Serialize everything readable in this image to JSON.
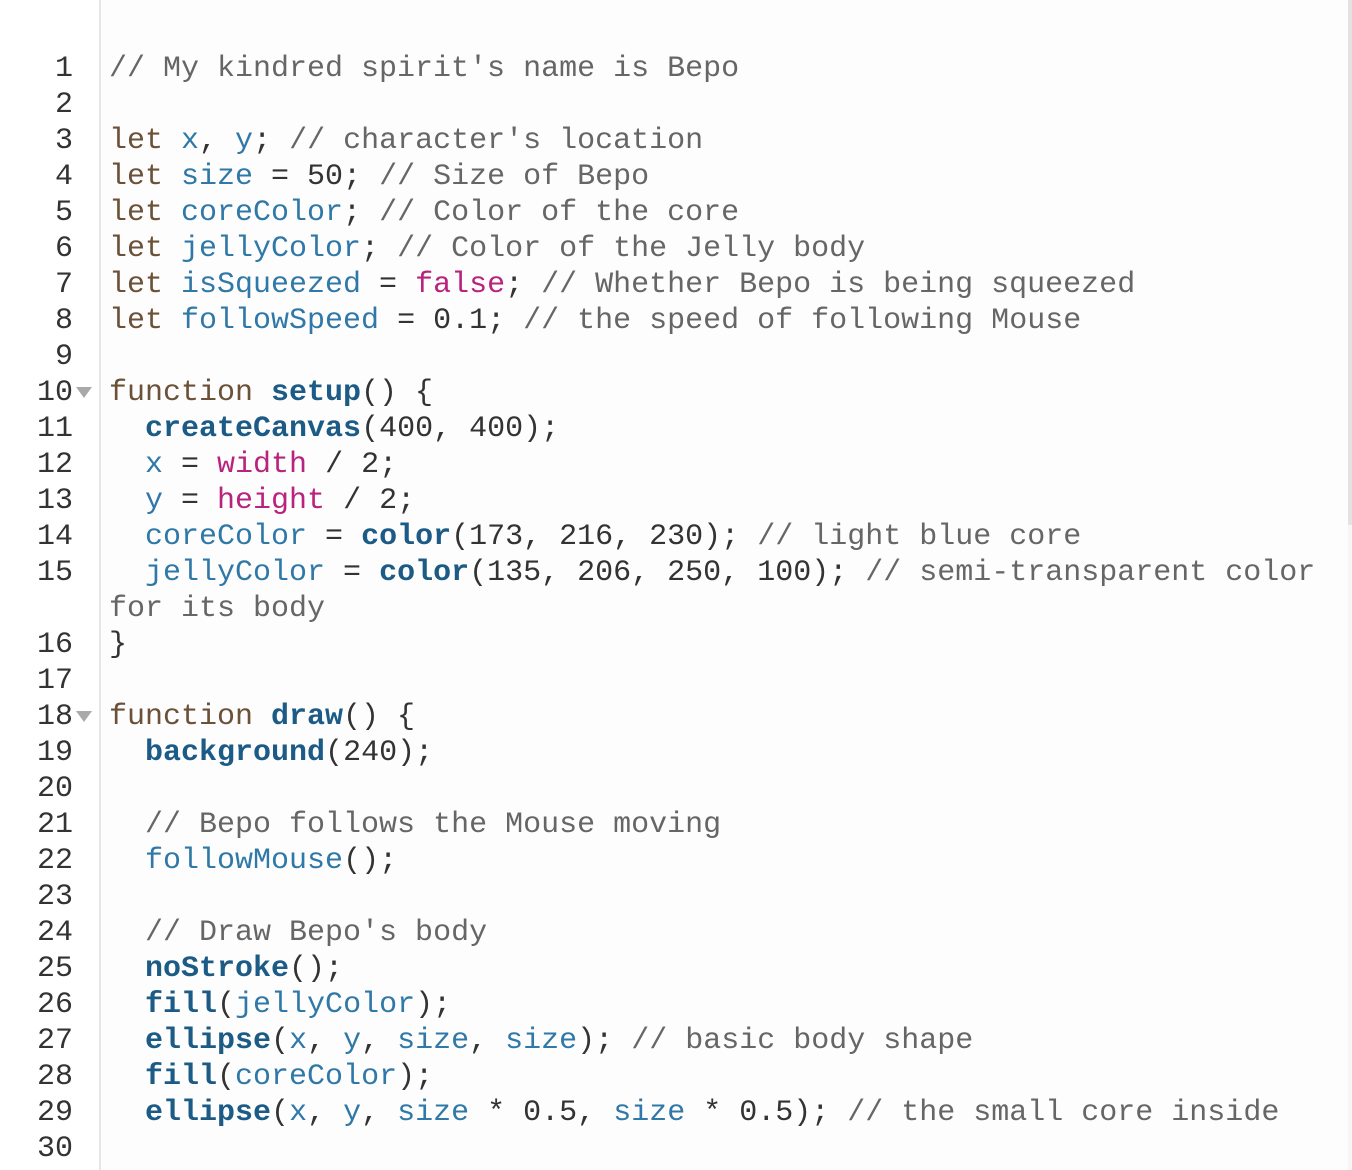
{
  "editor": {
    "lines": [
      {
        "n": "1",
        "fold": false,
        "tokens": [
          [
            "cm",
            "// My kindred spirit's name is Bepo"
          ]
        ]
      },
      {
        "n": "2",
        "fold": false,
        "tokens": []
      },
      {
        "n": "3",
        "fold": false,
        "tokens": [
          [
            "kw",
            "let "
          ],
          [
            "vr",
            "x"
          ],
          [
            "op",
            ", "
          ],
          [
            "vr",
            "y"
          ],
          [
            "op",
            "; "
          ],
          [
            "cm",
            "// character's location"
          ]
        ]
      },
      {
        "n": "4",
        "fold": false,
        "tokens": [
          [
            "kw",
            "let "
          ],
          [
            "vr",
            "size"
          ],
          [
            "op",
            " = "
          ],
          [
            "nm",
            "50"
          ],
          [
            "op",
            "; "
          ],
          [
            "cm",
            "// Size of Bepo"
          ]
        ]
      },
      {
        "n": "5",
        "fold": false,
        "tokens": [
          [
            "kw",
            "let "
          ],
          [
            "vr",
            "coreColor"
          ],
          [
            "op",
            "; "
          ],
          [
            "cm",
            "// Color of the core"
          ]
        ]
      },
      {
        "n": "6",
        "fold": false,
        "tokens": [
          [
            "kw",
            "let "
          ],
          [
            "vr",
            "jellyColor"
          ],
          [
            "op",
            "; "
          ],
          [
            "cm",
            "// Color of the Jelly body"
          ]
        ]
      },
      {
        "n": "7",
        "fold": false,
        "tokens": [
          [
            "kw",
            "let "
          ],
          [
            "vr",
            "isSqueezed"
          ],
          [
            "op",
            " = "
          ],
          [
            "bi",
            "false"
          ],
          [
            "op",
            "; "
          ],
          [
            "cm",
            "// Whether Bepo is being squeezed"
          ]
        ]
      },
      {
        "n": "8",
        "fold": false,
        "tokens": [
          [
            "kw",
            "let "
          ],
          [
            "vr",
            "followSpeed"
          ],
          [
            "op",
            " = "
          ],
          [
            "nm",
            "0.1"
          ],
          [
            "op",
            "; "
          ],
          [
            "cm",
            "// the speed of following Mouse"
          ]
        ]
      },
      {
        "n": "9",
        "fold": false,
        "tokens": []
      },
      {
        "n": "10",
        "fold": true,
        "tokens": [
          [
            "kw",
            "function "
          ],
          [
            "fn",
            "setup"
          ],
          [
            "op",
            "() {"
          ]
        ]
      },
      {
        "n": "11",
        "fold": false,
        "tokens": [
          [
            "op",
            "  "
          ],
          [
            "fn",
            "createCanvas"
          ],
          [
            "op",
            "("
          ],
          [
            "nm",
            "400"
          ],
          [
            "op",
            ", "
          ],
          [
            "nm",
            "400"
          ],
          [
            "op",
            ");"
          ]
        ]
      },
      {
        "n": "12",
        "fold": false,
        "tokens": [
          [
            "op",
            "  "
          ],
          [
            "vr",
            "x"
          ],
          [
            "op",
            " = "
          ],
          [
            "bi",
            "width"
          ],
          [
            "op",
            " / "
          ],
          [
            "nm",
            "2"
          ],
          [
            "op",
            ";"
          ]
        ]
      },
      {
        "n": "13",
        "fold": false,
        "tokens": [
          [
            "op",
            "  "
          ],
          [
            "vr",
            "y"
          ],
          [
            "op",
            " = "
          ],
          [
            "bi",
            "height"
          ],
          [
            "op",
            " / "
          ],
          [
            "nm",
            "2"
          ],
          [
            "op",
            ";"
          ]
        ]
      },
      {
        "n": "14",
        "fold": false,
        "tokens": [
          [
            "op",
            "  "
          ],
          [
            "vr",
            "coreColor"
          ],
          [
            "op",
            " = "
          ],
          [
            "fn",
            "color"
          ],
          [
            "op",
            "("
          ],
          [
            "nm",
            "173"
          ],
          [
            "op",
            ", "
          ],
          [
            "nm",
            "216"
          ],
          [
            "op",
            ", "
          ],
          [
            "nm",
            "230"
          ],
          [
            "op",
            "); "
          ],
          [
            "cm",
            "// light blue core"
          ]
        ]
      },
      {
        "n": "15",
        "fold": false,
        "wrap": true,
        "tokens": [
          [
            "op",
            "  "
          ],
          [
            "vr",
            "jellyColor"
          ],
          [
            "op",
            " = "
          ],
          [
            "fn",
            "color"
          ],
          [
            "op",
            "("
          ],
          [
            "nm",
            "135"
          ],
          [
            "op",
            ", "
          ],
          [
            "nm",
            "206"
          ],
          [
            "op",
            ", "
          ],
          [
            "nm",
            "250"
          ],
          [
            "op",
            ", "
          ],
          [
            "nm",
            "100"
          ],
          [
            "op",
            "); "
          ],
          [
            "cm",
            "// semi-transparent color for its body"
          ]
        ]
      },
      {
        "n": "16",
        "fold": false,
        "tokens": [
          [
            "op",
            "}"
          ]
        ]
      },
      {
        "n": "17",
        "fold": false,
        "tokens": []
      },
      {
        "n": "18",
        "fold": true,
        "tokens": [
          [
            "kw",
            "function "
          ],
          [
            "fn",
            "draw"
          ],
          [
            "op",
            "() {"
          ]
        ]
      },
      {
        "n": "19",
        "fold": false,
        "tokens": [
          [
            "op",
            "  "
          ],
          [
            "fn",
            "background"
          ],
          [
            "op",
            "("
          ],
          [
            "nm",
            "240"
          ],
          [
            "op",
            ");"
          ]
        ]
      },
      {
        "n": "20",
        "fold": false,
        "tokens": []
      },
      {
        "n": "21",
        "fold": false,
        "tokens": [
          [
            "op",
            "  "
          ],
          [
            "cm",
            "// Bepo follows the Mouse moving"
          ]
        ]
      },
      {
        "n": "22",
        "fold": false,
        "tokens": [
          [
            "op",
            "  "
          ],
          [
            "vr",
            "followMouse"
          ],
          [
            "op",
            "();"
          ]
        ]
      },
      {
        "n": "23",
        "fold": false,
        "tokens": []
      },
      {
        "n": "24",
        "fold": false,
        "tokens": [
          [
            "op",
            "  "
          ],
          [
            "cm",
            "// Draw Bepo's body"
          ]
        ]
      },
      {
        "n": "25",
        "fold": false,
        "tokens": [
          [
            "op",
            "  "
          ],
          [
            "fn",
            "noStroke"
          ],
          [
            "op",
            "();"
          ]
        ]
      },
      {
        "n": "26",
        "fold": false,
        "tokens": [
          [
            "op",
            "  "
          ],
          [
            "fn",
            "fill"
          ],
          [
            "op",
            "("
          ],
          [
            "vr",
            "jellyColor"
          ],
          [
            "op",
            ");"
          ]
        ]
      },
      {
        "n": "27",
        "fold": false,
        "tokens": [
          [
            "op",
            "  "
          ],
          [
            "fn",
            "ellipse"
          ],
          [
            "op",
            "("
          ],
          [
            "vr",
            "x"
          ],
          [
            "op",
            ", "
          ],
          [
            "vr",
            "y"
          ],
          [
            "op",
            ", "
          ],
          [
            "vr",
            "size"
          ],
          [
            "op",
            ", "
          ],
          [
            "vr",
            "size"
          ],
          [
            "op",
            "); "
          ],
          [
            "cm",
            "// basic body shape"
          ]
        ]
      },
      {
        "n": "28",
        "fold": false,
        "tokens": [
          [
            "op",
            "  "
          ],
          [
            "fn",
            "fill"
          ],
          [
            "op",
            "("
          ],
          [
            "vr",
            "coreColor"
          ],
          [
            "op",
            ");"
          ]
        ]
      },
      {
        "n": "29",
        "fold": false,
        "tokens": [
          [
            "op",
            "  "
          ],
          [
            "fn",
            "ellipse"
          ],
          [
            "op",
            "("
          ],
          [
            "vr",
            "x"
          ],
          [
            "op",
            ", "
          ],
          [
            "vr",
            "y"
          ],
          [
            "op",
            ", "
          ],
          [
            "vr",
            "size"
          ],
          [
            "op",
            " * "
          ],
          [
            "nm",
            "0.5"
          ],
          [
            "op",
            ", "
          ],
          [
            "vr",
            "size"
          ],
          [
            "op",
            " * "
          ],
          [
            "nm",
            "0.5"
          ],
          [
            "op",
            "); "
          ],
          [
            "cm",
            "// the small core inside"
          ]
        ]
      },
      {
        "n": "30",
        "fold": false,
        "tokens": []
      }
    ]
  }
}
